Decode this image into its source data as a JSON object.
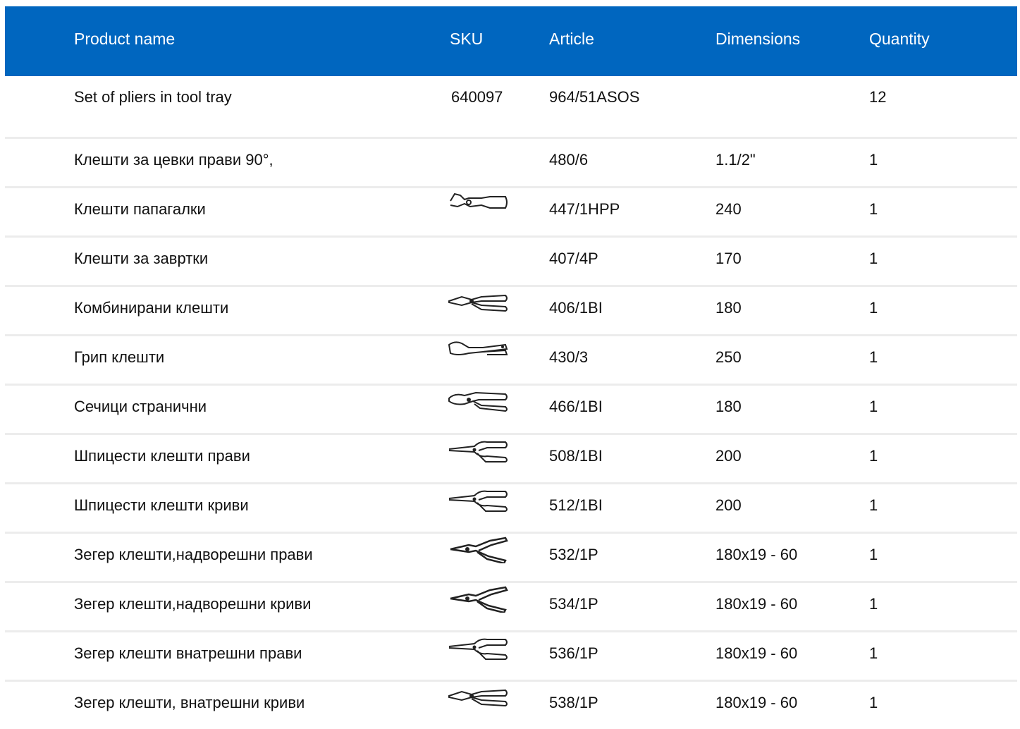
{
  "colors": {
    "header_bg": "#0066BF",
    "header_text": "#FFFFFF",
    "row_divider": "#ECECEC"
  },
  "table": {
    "headers": {
      "product_name": "Product name",
      "sku": "SKU",
      "article": "Article",
      "dimensions": "Dimensions",
      "quantity": "Quantity"
    },
    "main_row": {
      "product_name": "Set of pliers in tool tray",
      "sku": "640097",
      "article": "964/51ASOS",
      "dimensions": "",
      "quantity": "12"
    },
    "rows": [
      {
        "product_name": "Клешти за цевки прави 90°,",
        "article": "480/6",
        "dimensions": "1.1/2\"",
        "quantity": "1",
        "icon": ""
      },
      {
        "product_name": "Клешти папагалки",
        "article": "447/1HPP",
        "dimensions": "240",
        "quantity": "1",
        "icon": "water-pump-pliers-icon"
      },
      {
        "product_name": "Клешти за завртки",
        "article": "407/4P",
        "dimensions": "170",
        "quantity": "1",
        "icon": ""
      },
      {
        "product_name": "Комбинирани клешти",
        "article": "406/1BI",
        "dimensions": "180",
        "quantity": "1",
        "icon": "combination-pliers-icon"
      },
      {
        "product_name": "Грип клешти",
        "article": "430/3",
        "dimensions": "250",
        "quantity": "1",
        "icon": "locking-pliers-icon"
      },
      {
        "product_name": "Сечици странични",
        "article": "466/1BI",
        "dimensions": "180",
        "quantity": "1",
        "icon": "side-cutters-icon"
      },
      {
        "product_name": "Шпицести клешти прави",
        "article": "508/1BI",
        "dimensions": "200",
        "quantity": "1",
        "icon": "needle-nose-pliers-icon"
      },
      {
        "product_name": "Шпицести клешти криви",
        "article": "512/1BI",
        "dimensions": "200",
        "quantity": "1",
        "icon": "bent-nose-pliers-icon"
      },
      {
        "product_name": "Зегер клешти,надворешни прави",
        "article": "532/1P",
        "dimensions": "180x19 - 60",
        "quantity": "1",
        "icon": "circlip-pliers-external-straight-icon"
      },
      {
        "product_name": "Зегер клешти,надворешни криви",
        "article": "534/1P",
        "dimensions": "180x19 - 60",
        "quantity": "1",
        "icon": "circlip-pliers-external-bent-icon"
      },
      {
        "product_name": "Зегер клешти внатрешни прави",
        "article": "536/1P",
        "dimensions": "180x19 - 60",
        "quantity": "1",
        "icon": "circlip-pliers-internal-straight-icon"
      },
      {
        "product_name": "Зегер клешти, внатрешни криви",
        "article": "538/1P",
        "dimensions": "180x19 - 60",
        "quantity": "1",
        "icon": "circlip-pliers-internal-bent-icon"
      }
    ]
  }
}
